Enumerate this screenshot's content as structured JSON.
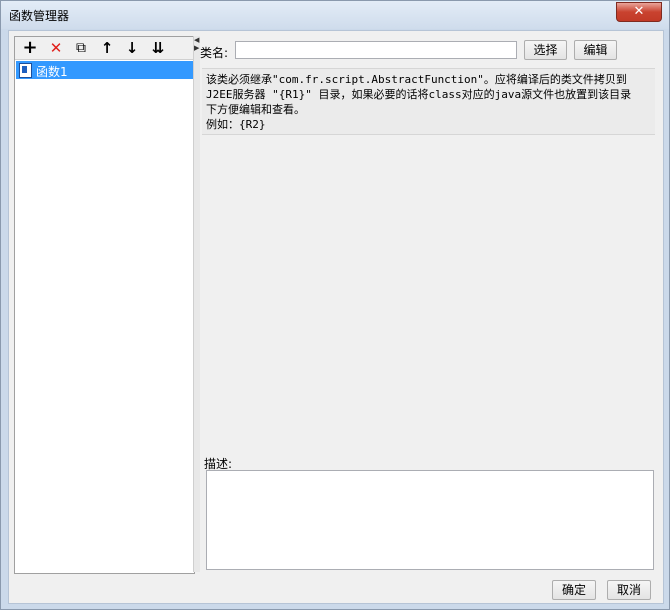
{
  "window": {
    "title": "函数管理器",
    "close_glyph": "✕"
  },
  "toolbar": {
    "add_glyph": "+",
    "delete_glyph": "✕",
    "copy_glyph": "⧉",
    "up_glyph": "↑",
    "down_glyph": "↓",
    "sort_glyph": "⇊"
  },
  "tree": {
    "items": [
      {
        "label": "函数1"
      }
    ]
  },
  "editor": {
    "class_label": "类名:",
    "class_value": "",
    "select_button": "选择",
    "edit_button": "编辑",
    "help_lines": [
      "该类必须继承\"com.fr.script.AbstractFunction\"。应将编译后的类文件拷贝到",
      "J2EE服务器 \"{R1}\" 目录，如果必要的话将class对应的java源文件也放置到该目录",
      "下方便编辑和查看。",
      "例如：{R2}"
    ],
    "description_label": "描述:",
    "description_value": ""
  },
  "footer": {
    "ok": "确定",
    "cancel": "取消"
  },
  "colors": {
    "selection": "#3399ff",
    "delete_red": "#e0201b",
    "accent_blue": "#1e5fbf"
  }
}
